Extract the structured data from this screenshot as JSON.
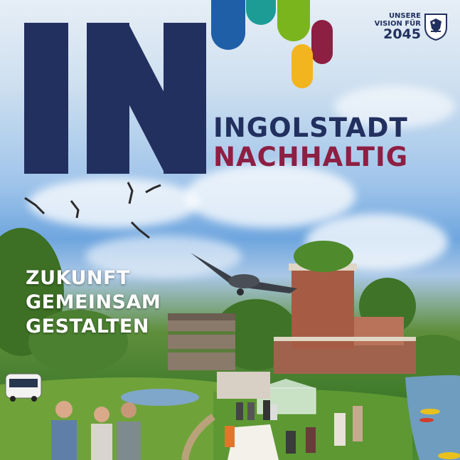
{
  "logo": {
    "big_letters": "IN",
    "colors": {
      "navy": "#22305f",
      "green": "#7ab51d",
      "teal": "#1d9c96",
      "blue": "#1f5fa8",
      "red": "#8d1f43",
      "yellow": "#f2b51f"
    }
  },
  "title": {
    "line1": "INGOLSTADT",
    "line2": "NACHHALTIG"
  },
  "vision": {
    "line1": "UNSERE",
    "line2": "VISION FÜR",
    "year": "2045"
  },
  "crest": {
    "icon": "ingolstadt-coat-of-arms-icon"
  },
  "slogan": {
    "line1": "ZUKUNFT",
    "line2": "GEMEINSAM",
    "line3": "GESTALTEN"
  },
  "scene": {
    "elements": [
      "storks",
      "air-taxi",
      "observatory-tower",
      "apartment-building",
      "greenhouse",
      "autonomous-shuttle",
      "people-picnic",
      "river-with-kayaks"
    ]
  }
}
